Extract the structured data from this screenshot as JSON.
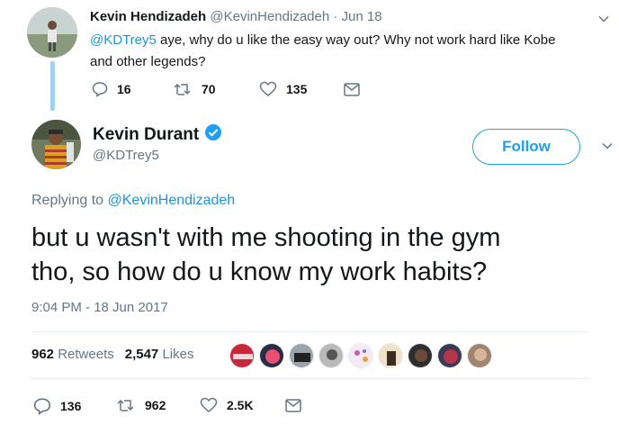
{
  "reply_tweet": {
    "author_name": "Kevin Hendizadeh",
    "author_handle": "@KevinHendizadeh",
    "date": "· Jun 18",
    "mention": "@KDTrey5",
    "text_line1": " aye, why do u like the easy way out? Why not work hard like Kobe",
    "text_line2": "and other legends?",
    "replies": "16",
    "retweets": "70",
    "likes": "135"
  },
  "main_tweet": {
    "author_name": "Kevin Durant",
    "author_handle": "@KDTrey5",
    "follow_label": "Follow",
    "replying_prefix": "Replying to ",
    "replying_to": "@KevinHendizadeh",
    "text_line1": "but u wasn't with me shooting in the gym",
    "text_line2": "tho, so how do u know my work habits?",
    "timestamp": "9:04 PM - 18 Jun 2017",
    "retweet_count": "962",
    "retweet_label": "Retweets",
    "like_count": "2,547",
    "like_label": "Likes",
    "replies": "136",
    "retweets": "962",
    "likes": "2.5K"
  },
  "colors": {
    "accent": "#1da1f2",
    "link": "#1b95e0",
    "secondary_text": "#657786",
    "thread_line": "#a4d0ef"
  }
}
